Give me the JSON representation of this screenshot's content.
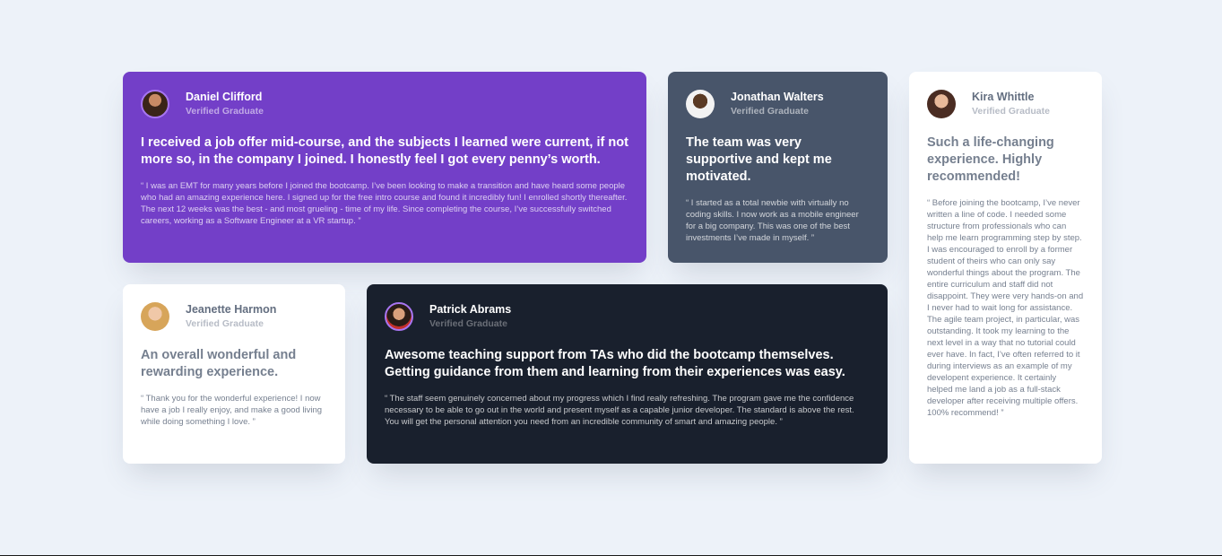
{
  "testimonials": [
    {
      "name": "Daniel Clifford",
      "role": "Verified Graduate",
      "headline": "I received a job offer mid-course, and the subjects I learned were current, if not more so, in the company I joined. I honestly feel I got every penny’s worth.",
      "quote": "“ I was an EMT for many years before I joined the bootcamp. I’ve been looking to make a transition and have heard some people who had an amazing experience here. I signed up for the free intro course and found it incredibly fun! I enrolled shortly thereafter. The next 12 weeks was the best - and most grueling - time of my life. Since completing the course, I’ve successfully switched careers, working as a Software Engineer at a VR startup. ”",
      "color": "#733fc8"
    },
    {
      "name": "Jonathan Walters",
      "role": "Verified Graduate",
      "headline": "The team was very supportive and kept me motivated.",
      "quote": "“ I started as a total newbie with virtually no coding skills. I now work as a mobile engineer for a big company. This was one of the best investments I’ve made in myself. ”",
      "color": "#48556a"
    },
    {
      "name": "Kira Whittle",
      "role": "Verified Graduate",
      "headline": "Such a life-changing experience. Highly recommended!",
      "quote": "“ Before joining the bootcamp, I’ve never written a line of code. I needed some structure from professionals who can help me learn programming step by step. I was encouraged to enroll by a former student of theirs who can only say wonderful things about the program. The entire curriculum and staff did not disappoint. They were very hands-on and I never had to wait long for assistance. The agile team project, in particular, was outstanding. It took my learning to the next level in a way that no tutorial could ever have. In fact, I’ve often referred to it during interviews as an example of my developent experience. It certainly helped me land a job as a full-stack developer after receiving multiple offers. 100% recommend! ”",
      "color": "#ffffff"
    },
    {
      "name": "Jeanette Harmon",
      "role": "Verified Graduate",
      "headline": "An overall wonderful and rewarding experience.",
      "quote": "“ Thank you for the wonderful experience! I now have a job I really enjoy, and make a good living while doing something I love. ”",
      "color": "#ffffff"
    },
    {
      "name": "Patrick Abrams",
      "role": "Verified Graduate",
      "headline": "Awesome teaching support from TAs who did the bootcamp themselves. Getting guidance from them and learning from their experiences was easy.",
      "quote": "“ The staff seem genuinely concerned about my progress which I find really refreshing. The program gave me the confidence necessary to be able to go out in the world and present myself as a capable junior developer. The standard is above the rest. You will get the personal attention you need from an incredible community of smart and amazing people. ”",
      "color": "#19202d"
    }
  ],
  "colors": {
    "background": "#edf2f9",
    "purple": "#733fc8",
    "grayish_blue": "#48556a",
    "dark_blue": "#19202d",
    "avatar_border": "#a775f1"
  }
}
